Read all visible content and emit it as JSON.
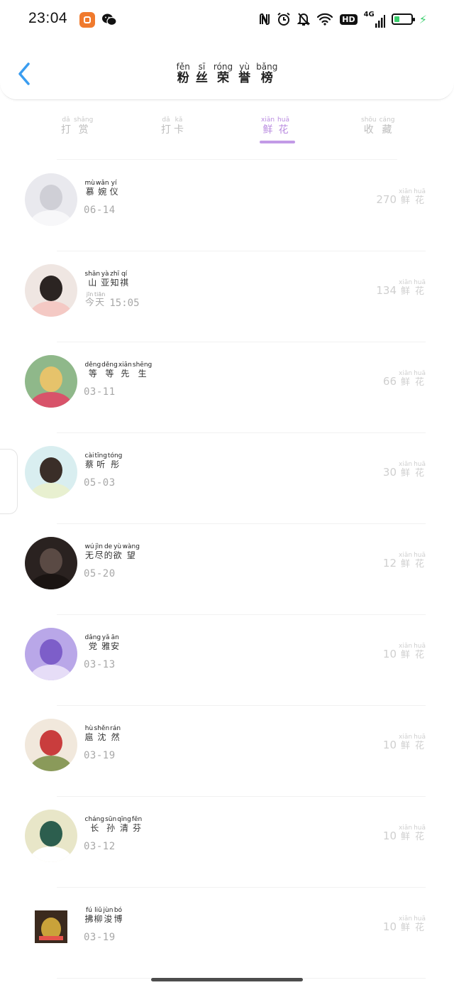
{
  "status_bar": {
    "time": "23:04",
    "right_icons": [
      "nfc-icon",
      "alarm-icon",
      "mute-icon",
      "wifi-icon",
      "hd-icon",
      "signal-4g-icon",
      "battery-icon",
      "charging-icon"
    ],
    "hd_label": "HD",
    "network_label": "4G",
    "battery_level": 0.35,
    "battery_color": "#3ccf6e"
  },
  "header": {
    "title": [
      {
        "py": "fěn",
        "hz": "粉"
      },
      {
        "py": "sī",
        "hz": "丝"
      },
      {
        "py": "róng",
        "hz": "荣"
      },
      {
        "py": "yù",
        "hz": "誉"
      },
      {
        "py": "bǎng",
        "hz": "榜"
      }
    ],
    "back_icon": "chevron-left-icon",
    "back_color": "#3a9df0"
  },
  "tabs": [
    {
      "id": "reward",
      "chars": [
        {
          "py": "dǎ",
          "hz": "打"
        },
        {
          "py": "shǎng",
          "hz": "赏"
        }
      ]
    },
    {
      "id": "checkin",
      "chars": [
        {
          "py": "dǎ",
          "hz": "打"
        },
        {
          "py": "kǎ",
          "hz": "卡"
        }
      ]
    },
    {
      "id": "flowers",
      "active": true,
      "chars": [
        {
          "py": "xiān",
          "hz": "鲜"
        },
        {
          "py": "huā",
          "hz": "花"
        }
      ]
    },
    {
      "id": "collect",
      "chars": [
        {
          "py": "shōu",
          "hz": "收"
        },
        {
          "py": "cáng",
          "hz": "藏"
        }
      ]
    }
  ],
  "accent_color": "#c29ae6",
  "unit": [
    {
      "py": "xiān",
      "hz": "鲜"
    },
    {
      "py": "huā",
      "hz": "花"
    }
  ],
  "fans": [
    {
      "name": [
        {
          "py": "mù",
          "hz": "慕"
        },
        {
          "py": "wǎn",
          "hz": "婉"
        },
        {
          "py": "yí",
          "hz": "仪"
        }
      ],
      "date": "06-14",
      "count": "270"
    },
    {
      "name": [
        {
          "py": "shān",
          "hz": "山"
        },
        {
          "py": "yà",
          "hz": "亚"
        },
        {
          "py": "zhī",
          "hz": "知"
        },
        {
          "py": "qí",
          "hz": "祺"
        }
      ],
      "date_ruby": [
        {
          "py": "jīn",
          "hz": "今"
        },
        {
          "py": "tiān",
          "hz": "天"
        }
      ],
      "date": "15:05",
      "count": "134"
    },
    {
      "name": [
        {
          "py": "děng",
          "hz": "等"
        },
        {
          "py": "děng",
          "hz": "等"
        },
        {
          "py": "xiān",
          "hz": "先"
        },
        {
          "py": "shēng",
          "hz": "生"
        }
      ],
      "date": "03-11",
      "count": "66"
    },
    {
      "name": [
        {
          "py": "cài",
          "hz": "蔡"
        },
        {
          "py": "tīng",
          "hz": "听"
        },
        {
          "py": "tóng",
          "hz": "彤"
        }
      ],
      "date": "05-03",
      "count": "30"
    },
    {
      "name": [
        {
          "py": "wú",
          "hz": "无"
        },
        {
          "py": "jìn",
          "hz": "尽"
        },
        {
          "py": "de",
          "hz": "的"
        },
        {
          "py": "yù",
          "hz": "欲"
        },
        {
          "py": "wàng",
          "hz": "望"
        }
      ],
      "date": "05-20",
      "count": "12"
    },
    {
      "name": [
        {
          "py": "dǎng",
          "hz": "党"
        },
        {
          "py": "yǎ",
          "hz": "雅"
        },
        {
          "py": "ān",
          "hz": "安"
        }
      ],
      "date": "03-13",
      "count": "10"
    },
    {
      "name": [
        {
          "py": "hù",
          "hz": "扈"
        },
        {
          "py": "shěn",
          "hz": "沈"
        },
        {
          "py": "rán",
          "hz": "然"
        }
      ],
      "date": "03-19",
      "count": "10"
    },
    {
      "name": [
        {
          "py": "cháng",
          "hz": "长"
        },
        {
          "py": "sūn",
          "hz": "孙"
        },
        {
          "py": "qīng",
          "hz": "清"
        },
        {
          "py": "fēn",
          "hz": "芬"
        }
      ],
      "date": "03-12",
      "count": "10"
    },
    {
      "name": [
        {
          "py": "fú",
          "hz": "拂"
        },
        {
          "py": "liǔ",
          "hz": "柳"
        },
        {
          "py": "jùn",
          "hz": "浚"
        },
        {
          "py": "bó",
          "hz": "博"
        }
      ],
      "date": "03-19",
      "count": "10"
    }
  ]
}
